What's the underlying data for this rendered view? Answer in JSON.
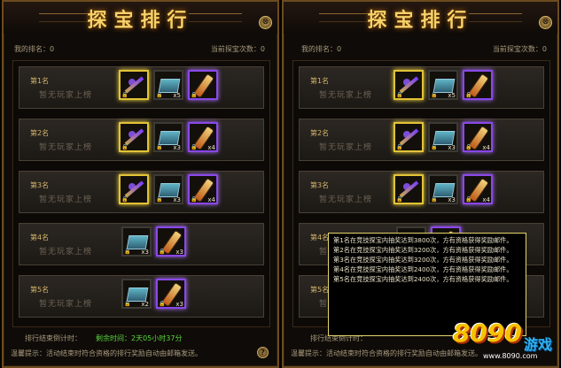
{
  "title": "探宝排行",
  "close_glyph": "⊗",
  "my_rank_label": "我的排名：0",
  "count_label": "当前探宝次数：0",
  "no_player": "暂无玩家上榜",
  "ranks": [
    {
      "label": "第1名",
      "items": [
        {
          "kind": "sword",
          "frame": "gold",
          "count": ""
        },
        {
          "kind": "box",
          "frame": "gray",
          "count": "x5"
        },
        {
          "kind": "tube",
          "frame": "purple",
          "count": ""
        }
      ]
    },
    {
      "label": "第2名",
      "items": [
        {
          "kind": "sword",
          "frame": "gold",
          "count": ""
        },
        {
          "kind": "box",
          "frame": "gray",
          "count": "x3"
        },
        {
          "kind": "tube",
          "frame": "purple",
          "count": "x4"
        }
      ]
    },
    {
      "label": "第3名",
      "items": [
        {
          "kind": "sword",
          "frame": "gold",
          "count": ""
        },
        {
          "kind": "box",
          "frame": "gray",
          "count": "x3"
        },
        {
          "kind": "tube",
          "frame": "purple",
          "count": "x4"
        }
      ]
    },
    {
      "label": "第4名",
      "items": [
        {
          "kind": "box",
          "frame": "gray",
          "count": "x3"
        },
        {
          "kind": "tube",
          "frame": "purple",
          "count": "x3"
        }
      ]
    },
    {
      "label": "第5名",
      "items": [
        {
          "kind": "box",
          "frame": "gray",
          "count": "x2"
        },
        {
          "kind": "tube",
          "frame": "purple",
          "count": "x3"
        }
      ]
    }
  ],
  "rank_end_label": "排行结束倒计时：",
  "remaining_label": "剩余时间：2天05小时37分",
  "tip": "温馨提示：活动结束时符合资格的排行奖励自动由邮箱发送。",
  "help_glyph": "?",
  "tooltip_lines": [
    "第1名在竞技探宝内抽奖达到3800次，方有资格获得奖励邮件。",
    "第2名在竞技探宝内抽奖达到3200次，方有资格获得奖励邮件。",
    "第3名在竞技探宝内抽奖达到3200次，方有资格获得奖励邮件。",
    "第4名在竞技探宝内抽奖达到2400次，方有资格获得奖励邮件。",
    "第5名在竞技探宝内抽奖达到2400次，方有资格获得奖励邮件。"
  ],
  "logo": {
    "num": "8090",
    "zh": "游戏",
    "domain": "www.8090.com"
  },
  "colors": {
    "accent_gold": "#f5d36a",
    "time_green": "#58d63e",
    "tooltip_border": "#e5d46a"
  }
}
